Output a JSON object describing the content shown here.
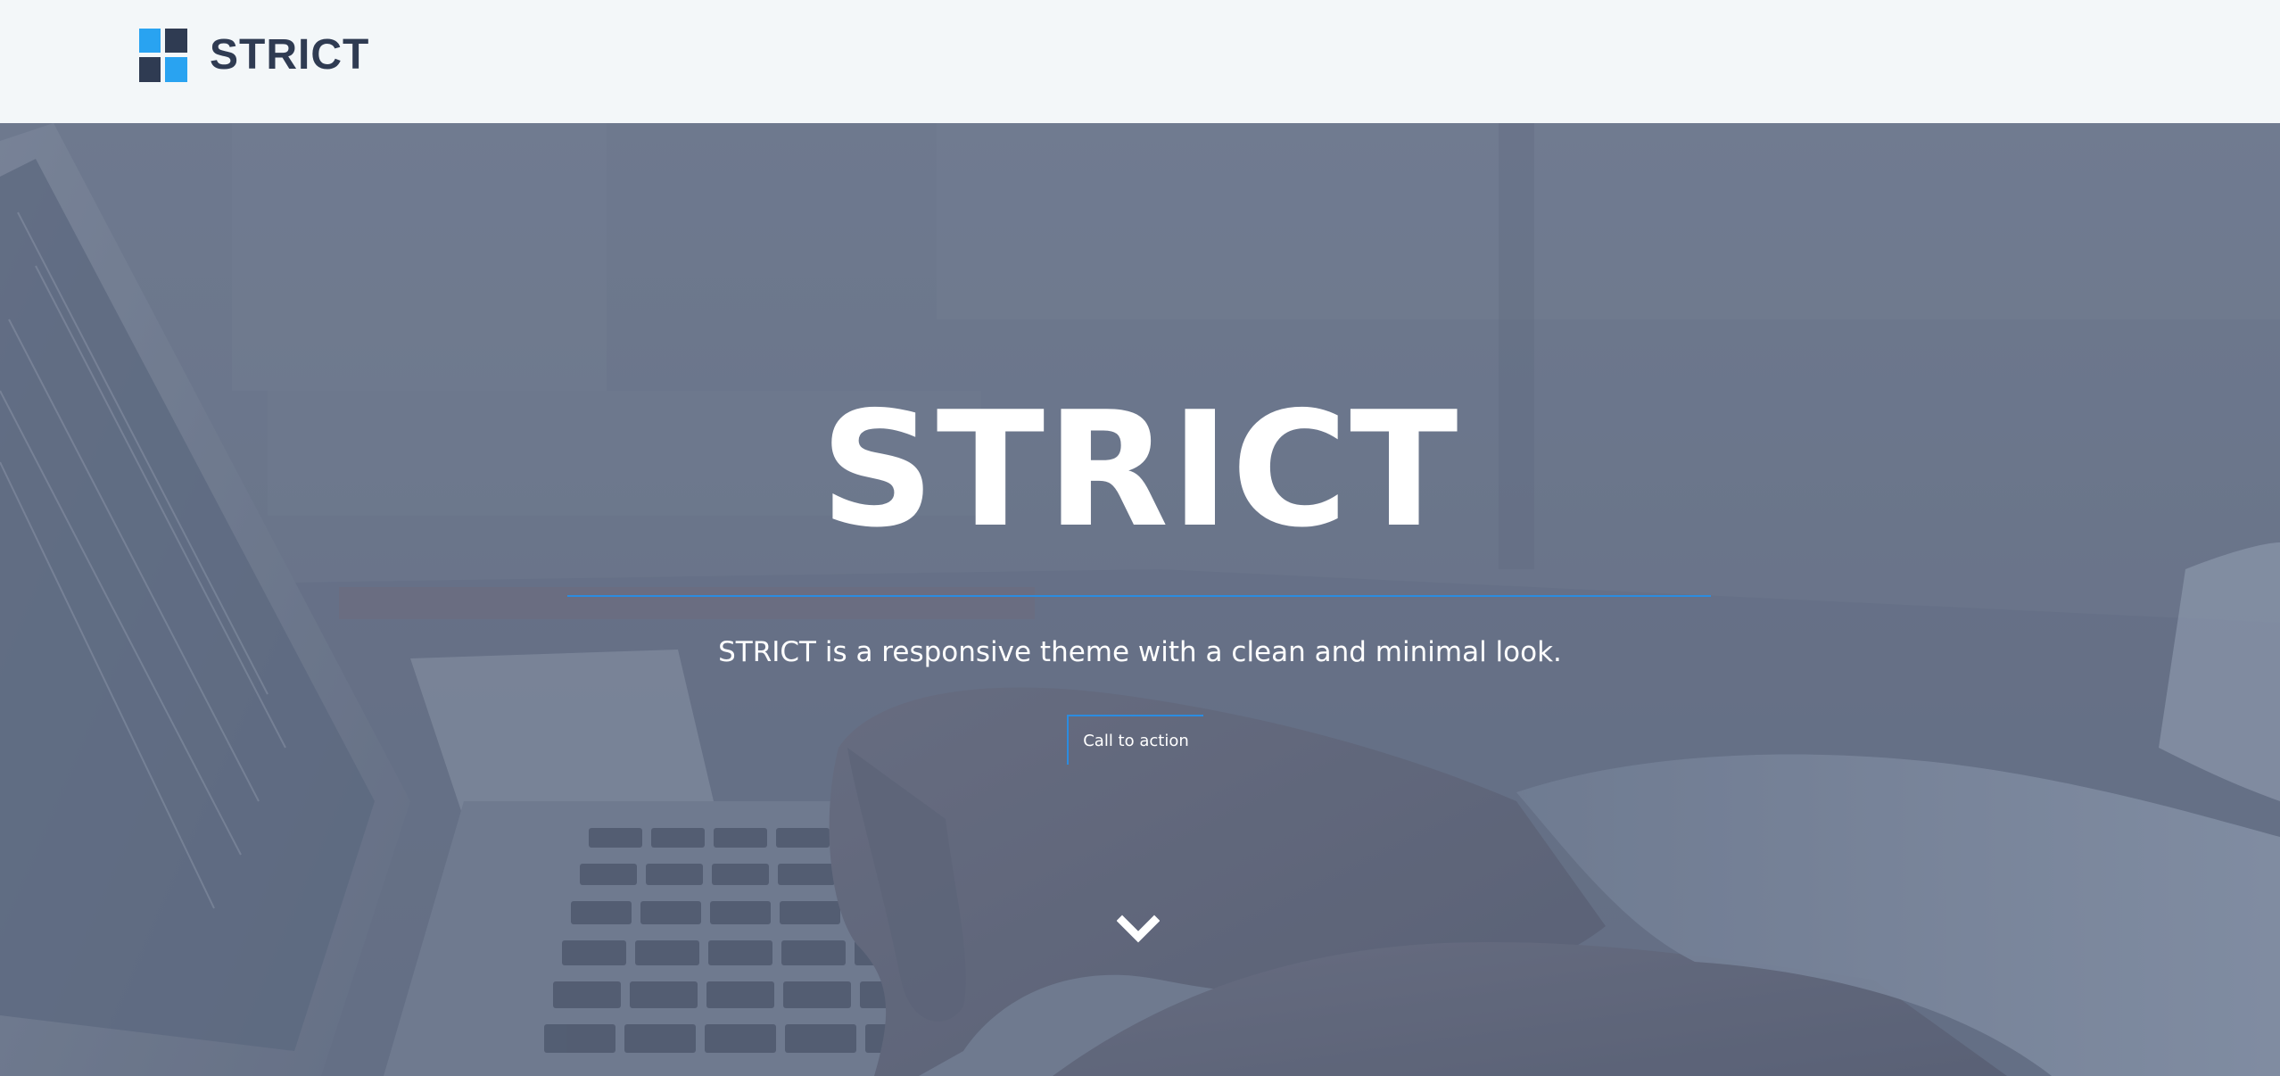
{
  "colors": {
    "header_bg": "#f3f7f9",
    "brand_text": "#2f3b52",
    "logo_light": "#29a3f1",
    "logo_dark": "#2f3b52",
    "accent": "#2b8ce0",
    "hero_text": "#ffffff"
  },
  "header": {
    "brand_name": "STRICT",
    "logo_icon": "four-square-grid-icon"
  },
  "hero": {
    "title": "STRICT",
    "subtitle": "STRICT is a responsive theme with a clean and minimal look.",
    "cta_label": "Call to action",
    "scroll_icon": "chevron-down-icon",
    "background": "photo-hands-typing-on-laptop"
  }
}
